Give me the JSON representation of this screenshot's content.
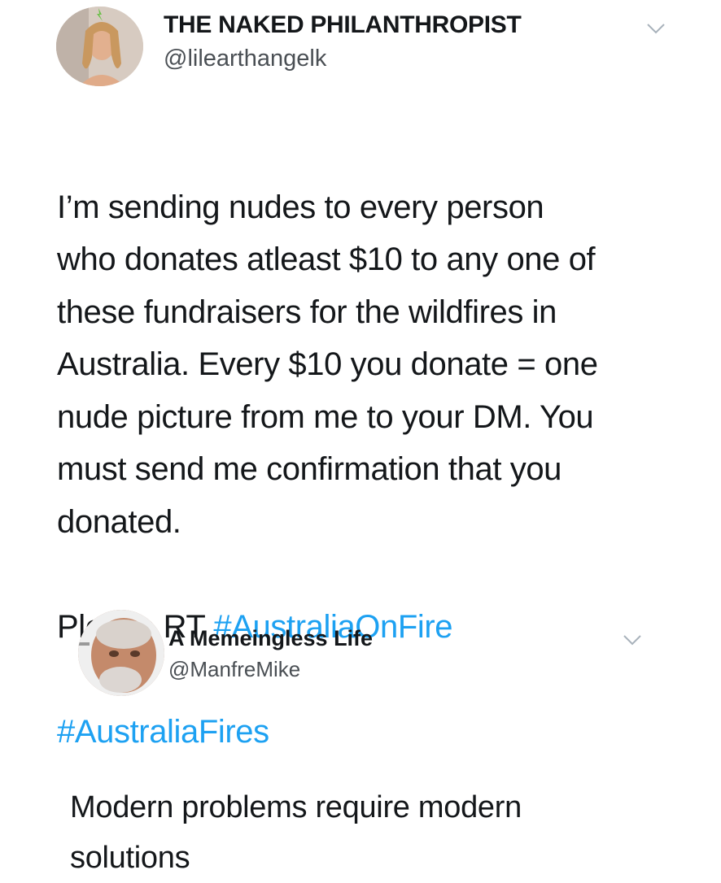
{
  "tweets": [
    {
      "display_name": "THE NAKED PHILANTHROPIST",
      "handle": "@lilearthangelk",
      "text": "I’m sending nudes to every person\nwho donates atleast $10 to any one of\nthese fundraisers for the wildfires in\nAustralia. Every $10 you donate = one\nnude picture from me to your DM. You\nmust send me confirmation that you\ndonated.",
      "rt_prefix": "Please RT ",
      "hashtags": [
        "#AustraliaOnFire",
        "#AustraliaFires"
      ]
    },
    {
      "display_name": "A Memeingless Life",
      "handle": "@ManfreMike",
      "text": "Modern problems require modern\nsolutions"
    }
  ],
  "colors": {
    "hashtag": "#1da1f2",
    "text": "#14171a",
    "handle": "#4a4f54",
    "chevron": "#a8b2bb"
  },
  "icons": {
    "menu": "chevron-down-icon"
  }
}
